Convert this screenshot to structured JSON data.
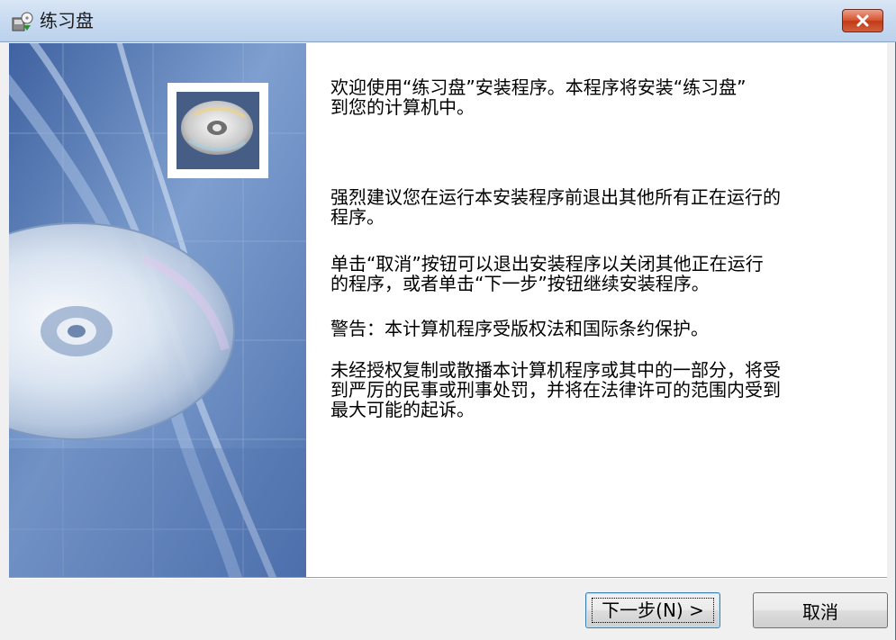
{
  "window": {
    "title": "练习盘",
    "app_icon": "setup-app-icon",
    "close_icon": "close-icon"
  },
  "banner": {
    "image": "cd-disc-banner-image",
    "thumbnail": "cd-disc-thumbnail-icon"
  },
  "content": {
    "paragraphs": [
      "欢迎使用“练习盘”安装程序。本程序将安装“练习盘”\n到您的计算机中。",
      "强烈建议您在运行本安装程序前退出其他所有正在运行的\n程序。",
      "单击“取消”按钮可以退出安装程序以关闭其他正在运行\n的程序，或者单击“下一步”按钮继续安装程序。",
      "警告：本计算机程序受版权法和国际条约保护。",
      "未经授权复制或散播本计算机程序或其中的一部分，将受\n到严厉的民事或刑事处罚，并将在法律许可的范围内受到\n最大可能的起诉。"
    ]
  },
  "buttons": {
    "next_label": "下一步(N) >",
    "cancel_label": "取消"
  },
  "colors": {
    "close_button": "#c94a2a",
    "banner_blue": "#5b7fb6",
    "title_bar": "#c7daf0"
  }
}
